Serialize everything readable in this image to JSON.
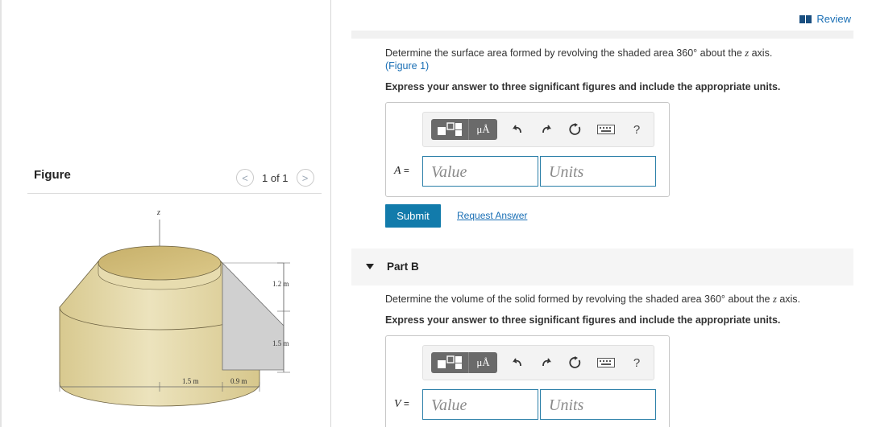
{
  "figure_panel": {
    "title": "Figure",
    "pager_label": "1 of 1",
    "prev_glyph": "<",
    "next_glyph": ">",
    "axis_label": "z",
    "dim_top_right": "1.2 m",
    "dim_bottom_right": "1.5 m",
    "dim_bottom_left": "1.5 m",
    "dim_bottom_mid": "0.9 m"
  },
  "header": {
    "review_label": "Review"
  },
  "part_a": {
    "question": "Determine the surface area formed by revolving the shaded area 360° about the ",
    "question_axis": "z",
    "question_end": " axis.",
    "figure_link": "(Figure 1)",
    "instruction": "Express your answer to three significant figures and include the appropriate units.",
    "var_letter": "A",
    "var_eq": " =",
    "value_placeholder": "Value",
    "units_placeholder": "Units",
    "submit_label": "Submit",
    "request_label": "Request Answer"
  },
  "part_b": {
    "title": "Part B",
    "question": "Determine the volume of the solid formed by revolving the shaded area 360° about the ",
    "question_axis": "z",
    "question_end": " axis.",
    "instruction": "Express your answer to three significant figures and include the appropriate units.",
    "var_letter": "V",
    "var_eq": " =",
    "value_placeholder": "Value",
    "units_placeholder": "Units"
  },
  "toolbar": {
    "units_label": "μÅ",
    "help_label": "?"
  },
  "icons": {
    "templates": "templates-icon",
    "undo": "undo-icon",
    "redo": "redo-icon",
    "reset": "reset-icon",
    "keyboard": "keyboard-icon",
    "help": "help-icon",
    "review": "book-icon",
    "caret": "caret-down-icon"
  },
  "colors": {
    "accent": "#127bab",
    "link": "#1a6fb5",
    "solid_light": "#e6dcae",
    "solid_dark": "#c9b77a",
    "shade_gray": "#cfcfcf"
  }
}
